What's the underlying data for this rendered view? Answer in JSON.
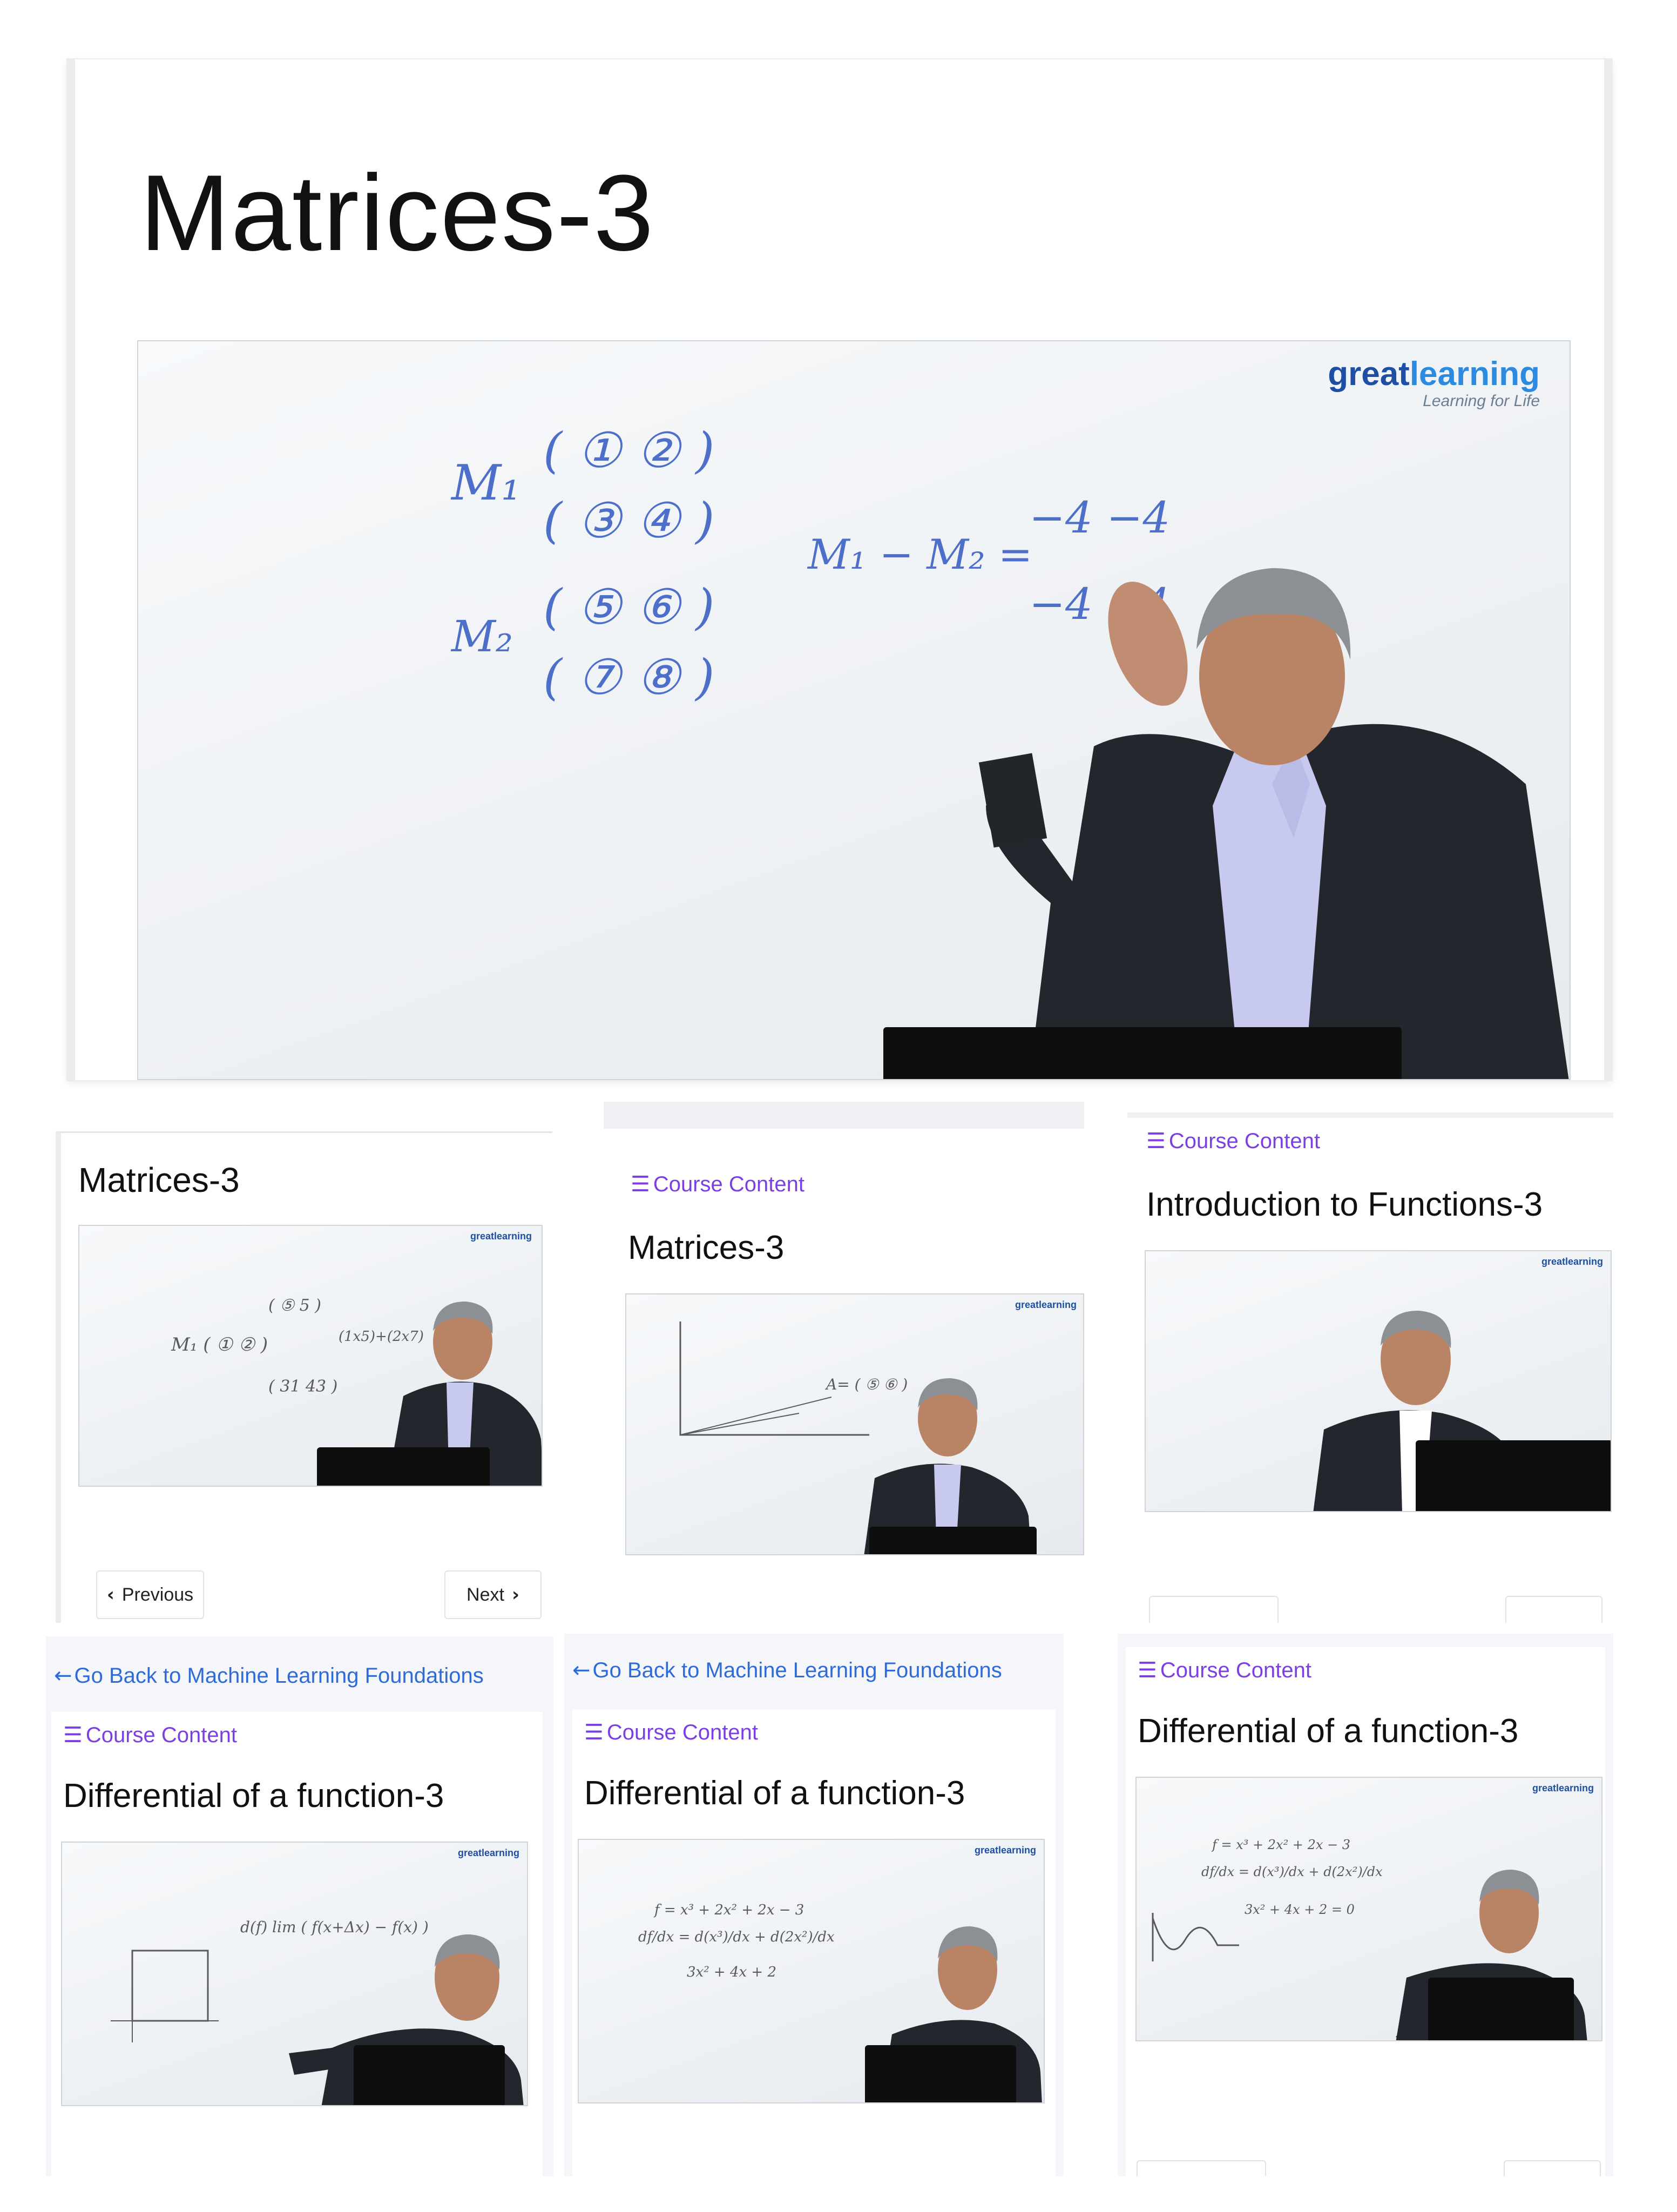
{
  "main": {
    "title": "Matrices-3",
    "video": {
      "logo_a": "great",
      "logo_b": "learning",
      "logo_tag": "Learning for Life"
    },
    "board": {
      "m1": "M₁",
      "m2": "M₂",
      "r1": "( ① ② )",
      "r2": "( ③ ④ )",
      "r3": "( ⑤ ⑥ )",
      "r4": "( ⑦ ⑧ )",
      "eq": "M₁ − M₂ =",
      "res1": "−4  −4",
      "res2": "−4  −4"
    }
  },
  "screens": [
    {
      "title": "Matrices-3",
      "logo": "greatlearning",
      "prev_label": "Previous",
      "next_label": "Next"
    },
    {
      "course_content": "Course Content",
      "title": "Matrices-3",
      "logo": "greatlearning"
    },
    {
      "course_content": "Course Content",
      "title": "Introduction to Functions-3",
      "logo": "greatlearning"
    },
    {
      "back_link": "Go Back to Machine Learning Foundations",
      "course_content": "Course Content",
      "title": "Differential of a function-3",
      "logo": "greatlearning"
    },
    {
      "back_link": "Go Back to Machine Learning Foundations",
      "course_content": "Course Content",
      "title": "Differential of a function-3",
      "logo": "greatlearning"
    },
    {
      "course_content": "Course Content",
      "title": "Differential of a function-3",
      "logo": "greatlearning"
    }
  ],
  "icons": {
    "list": "list-icon",
    "back": "arrow-left-icon",
    "prev": "chevron-left-icon",
    "next": "chevron-right-icon"
  },
  "colors": {
    "course_content": "#7b3fe4",
    "back_link": "#2f6bd8",
    "logo_dark": "#1f4fa3",
    "logo_light": "#2c8be0"
  }
}
